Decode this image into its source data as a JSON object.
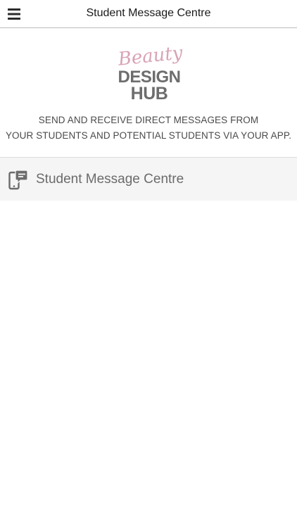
{
  "header": {
    "title": "Student Message Centre",
    "menu_icon": "hamburger-menu-icon"
  },
  "logo": {
    "script_text": "Beauty",
    "line1": "DESIGN",
    "line2": "HUB",
    "script_color": "#d9a3b4",
    "text_color": "#6d6d6d"
  },
  "description": {
    "line1": "SEND AND RECEIVE DIRECT MESSAGES FROM",
    "line2": "YOUR STUDENTS AND POTENTIAL STUDENTS VIA YOUR APP."
  },
  "list": {
    "items": [
      {
        "label": "Student Message Centre",
        "icon": "phone-chat-icon"
      }
    ]
  },
  "colors": {
    "header_border": "#bdbdbd",
    "list_background": "#f5f5f5",
    "list_text": "#6b6b6b",
    "icon_color": "#6b6b6b"
  }
}
